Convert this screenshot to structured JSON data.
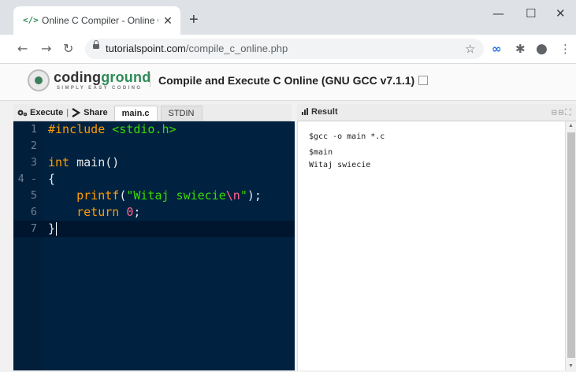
{
  "browser": {
    "tab_title": "Online C Compiler - Online C Edi",
    "tab_favicon": "</>",
    "close_glyph": "✕",
    "new_tab_glyph": "+",
    "minimize_glyph": "—",
    "maximize_glyph": "☐",
    "window_close_glyph": "✕",
    "back_glyph": "←",
    "forward_glyph": "→",
    "reload_glyph": "↻",
    "url_host": "tutorialspoint.com",
    "url_path": "/compile_c_online.php",
    "star_glyph": "☆",
    "ext1_glyph": "∞",
    "ext2_glyph": "✱",
    "profile_glyph": "●",
    "menu_glyph": "⋮"
  },
  "site": {
    "logo_word_a": "coding",
    "logo_word_b": "ground",
    "logo_sub": "SIMPLY EASY CODING",
    "title": "Compile and Execute C Online (GNU GCC v7.1.1)"
  },
  "editor": {
    "execute_label": "Execute",
    "separator": "|",
    "share_label": "Share",
    "tabs": [
      {
        "label": "main.c",
        "active": true
      },
      {
        "label": "STDIN",
        "active": false
      }
    ],
    "line_numbers": [
      "1",
      "2",
      "3",
      "4 -",
      "5",
      "6",
      "7"
    ]
  },
  "result": {
    "label": "Result",
    "icons_text": "⊟⊟⛶",
    "lines": [
      "$gcc -o main *.c",
      "$main",
      "Witaj swiecie"
    ]
  }
}
